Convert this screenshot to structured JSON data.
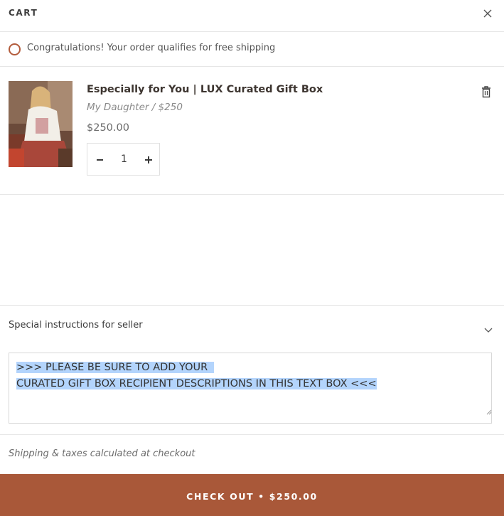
{
  "header": {
    "title": "CART",
    "close_icon": "close-icon"
  },
  "notice": {
    "text": "Congratulations! Your order qualifies for free shipping",
    "icon": "circle-icon",
    "accent_color": "#b35c3c"
  },
  "item": {
    "title": "Especially for You | LUX Curated Gift Box",
    "variant": "My Daughter / $250",
    "price": "$250.00",
    "quantity": "1",
    "image": "product-thumbnail",
    "remove_icon": "trash-icon"
  },
  "special_instructions": {
    "label": "Special instructions for seller",
    "toggle_icon": "chevron-down-icon",
    "line1": ">>> PLEASE BE SURE TO ADD YOUR",
    "line2": "CURATED GIFT BOX RECIPIENT DESCRIPTIONS IN THIS TEXT BOX <<<"
  },
  "shipping_note": "Shipping & taxes calculated at checkout",
  "checkout": {
    "label": "CHECK OUT • $250.00",
    "color": "#a95839"
  }
}
